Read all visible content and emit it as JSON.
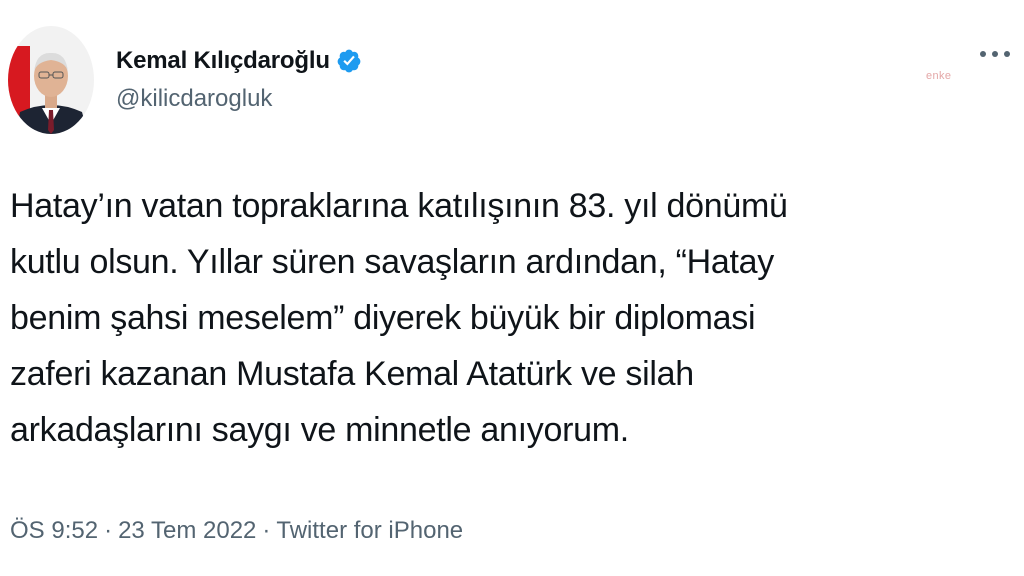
{
  "author": {
    "display_name": "Kemal Kılıçdaroğlu",
    "handle": "@kilicdarogluk",
    "verified_icon": "verified-badge-icon",
    "badge_color": "#1d9bf0"
  },
  "watermark": "enke",
  "tweet": {
    "lines": [
      "Hatay’ın vatan topraklarına katılışının 83. yıl dönümü",
      "kutlu olsun. Yıllar süren savaşların ardından, “Hatay",
      "benim şahsi meselem” diyerek büyük bir diplomasi",
      "zaferi kazanan Mustafa Kemal Atatürk ve silah",
      "arkadaşlarını saygı ve minnetle anıyorum."
    ]
  },
  "meta": {
    "time": "ÖS 9:52",
    "separator": "·",
    "date": "23 Tem 2022",
    "source": "Twitter for iPhone"
  },
  "colors": {
    "text": "#0f1419",
    "secondary": "#536471",
    "accent": "#1d9bf0"
  }
}
